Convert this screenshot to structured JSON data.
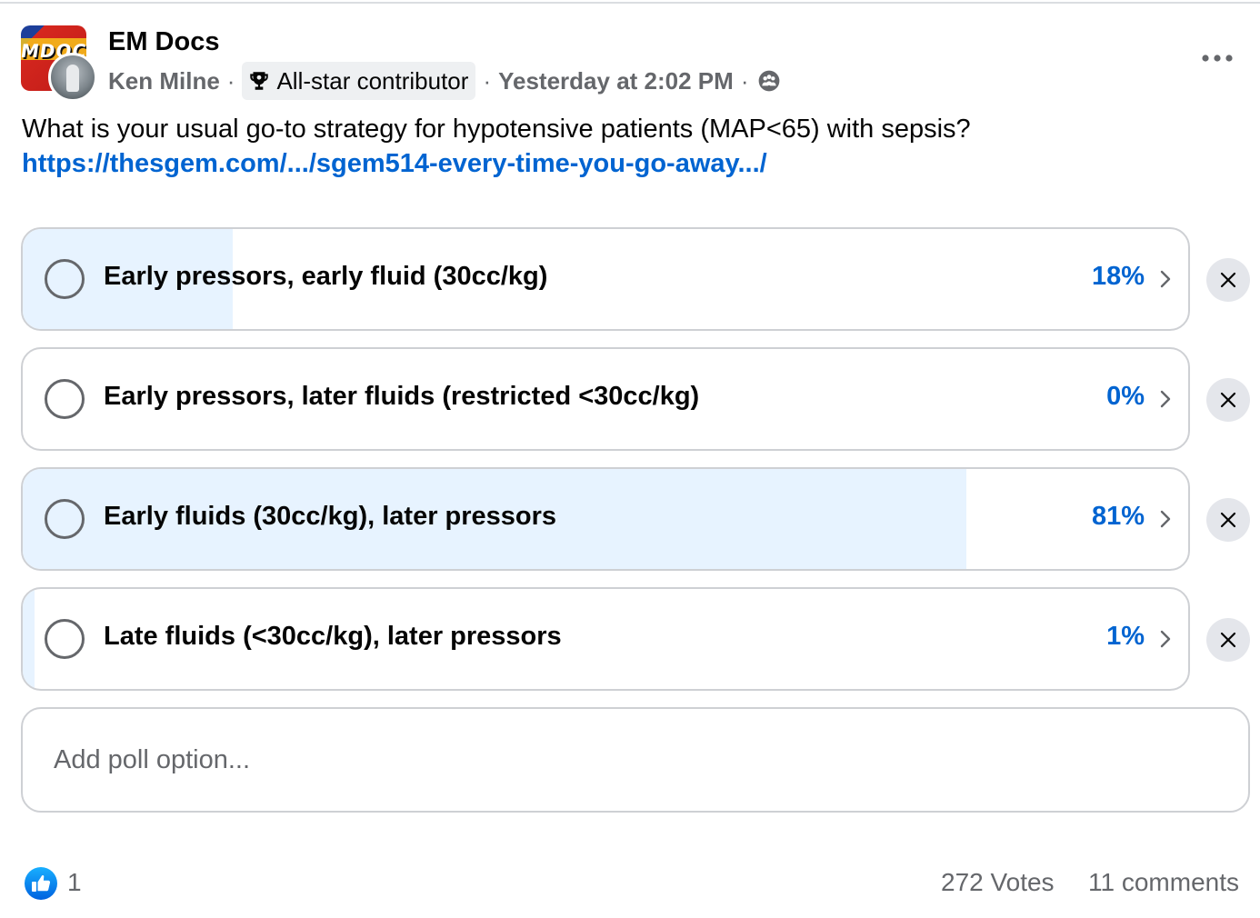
{
  "header": {
    "group_name": "EM Docs",
    "group_logo_text": "MDOCS",
    "author": "Ken Milne",
    "badge_label": "All-star contributor",
    "badge_icon": "trophy-icon",
    "timestamp": "Yesterday at 2:02 PM",
    "privacy_icon": "members-icon",
    "more_icon": "more-horizontal-icon"
  },
  "post": {
    "question": "What is your usual go-to strategy for hypotensive patients (MAP<65) with sepsis?",
    "link": "https://thesgem.com/.../sgem514-every-time-you-go-away.../"
  },
  "poll": {
    "options": [
      {
        "label": "Early pressors, early fluid (30cc/kg)",
        "percent_label": "18%",
        "fill_fraction": 0.18
      },
      {
        "label": "Early pressors, later fluids (restricted <30cc/kg)",
        "percent_label": "0%",
        "fill_fraction": 0.0
      },
      {
        "label": "Early fluids (30cc/kg), later pressors",
        "percent_label": "81%",
        "fill_fraction": 0.81
      },
      {
        "label": "Late fluids (<30cc/kg), later pressors",
        "percent_label": "1%",
        "fill_fraction": 0.01
      }
    ],
    "add_option_placeholder": "Add poll option...",
    "remove_icon": "close-icon"
  },
  "footer": {
    "like_icon": "like-thumb-icon",
    "like_count": "1",
    "votes": "272 Votes",
    "comments": "11 comments"
  },
  "colors": {
    "accent": "#0064d1",
    "poll_fill": "#e7f3ff",
    "like_blue": "#1877f2",
    "secondary_text": "#65676b"
  }
}
